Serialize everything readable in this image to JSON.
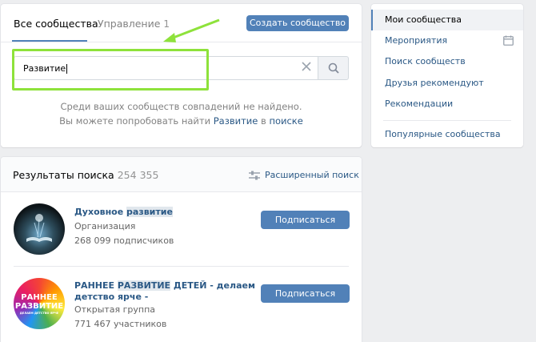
{
  "tabs": {
    "all": "Все сообщества",
    "manage": "Управление",
    "manage_count": "1"
  },
  "create_button": "Создать сообщество",
  "search": {
    "value": "Развитие"
  },
  "empty": {
    "line1": "Среди ваших сообществ совпадений не найдено.",
    "line2_prefix": "Вы можете попробовать найти",
    "line2_query": "Развитие",
    "line2_in": "в",
    "line2_link": "поиске"
  },
  "results": {
    "title": "Результаты поиска",
    "count": "254 355",
    "advanced": "Расширенный поиск",
    "groups": [
      {
        "name_pre": "Духовное ",
        "name_hl": "развитие",
        "name_post": "",
        "type": "Организация",
        "members": "268 099 подписчиков",
        "button": "Подписаться"
      },
      {
        "name_pre": "РАННЕЕ ",
        "name_hl": "РАЗВИТИЕ",
        "name_post": " ДЕТЕЙ - делаем детство ярче -",
        "type": "Открытая группа",
        "members": "771 467 участников",
        "button": "Подписаться",
        "avatar_text": [
          "РАННЕЕ",
          "РАЗВИТИЕ",
          "ДЕЛАЕМ ДЕТСТВО ЯРЧЕ"
        ]
      }
    ]
  },
  "sidebar": {
    "items": [
      {
        "label": "Мои сообщества",
        "active": true
      },
      {
        "label": "Мероприятия"
      },
      {
        "label": "Поиск сообществ"
      },
      {
        "label": "Друзья рекомендуют"
      },
      {
        "label": "Рекомендации"
      },
      {
        "label": "Популярные сообщества"
      }
    ]
  },
  "colors": {
    "accent": "#5181b8",
    "link": "#2a5885",
    "highlight_box": "#8ee23b",
    "arrow": "#8ee23b"
  },
  "icons": [
    "search-icon",
    "clear-icon",
    "filter-icon",
    "calendar-icon",
    "arrow-annotation"
  ]
}
